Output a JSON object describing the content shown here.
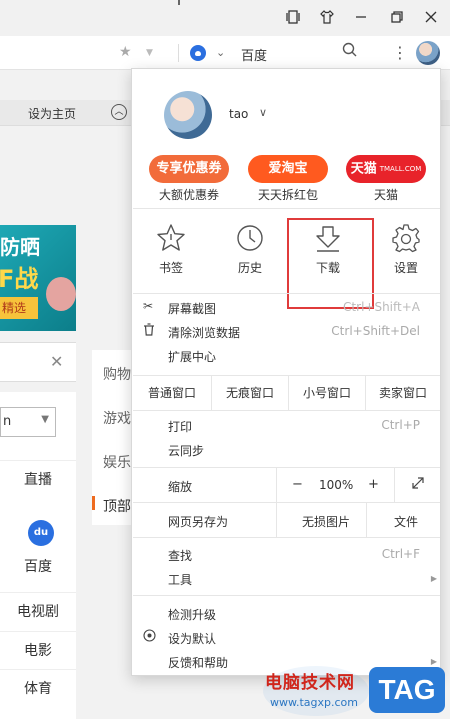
{
  "browser": {
    "search_engine": "百度"
  },
  "page": {
    "bookmark_set_home": "设为主页",
    "banner": {
      "line1": "防晒",
      "line2": "F战",
      "button": "精选"
    },
    "select_value": "n",
    "categories": [
      "直播",
      "百度",
      "电视剧",
      "电影",
      "体育"
    ],
    "baidu_logo_text": "du",
    "mid_items": [
      "购物",
      "游戏",
      "娱乐",
      "顶部"
    ]
  },
  "menu": {
    "username": "tao",
    "promos": [
      {
        "label": "专享优惠券",
        "caption": "大额优惠券",
        "color": "#f26b3a"
      },
      {
        "label": "爱淘宝",
        "caption": "天天拆红包",
        "color": "#ff5a1f"
      },
      {
        "label": "天猫",
        "sub": "TMALL.COM",
        "caption": "天猫",
        "color": "#e8232a"
      }
    ],
    "tools": [
      {
        "label": "书签",
        "icon": "star-icon"
      },
      {
        "label": "历史",
        "icon": "clock-icon"
      },
      {
        "label": "下载",
        "icon": "download-icon"
      },
      {
        "label": "设置",
        "icon": "gear-icon"
      }
    ],
    "screenshot": {
      "label": "屏幕截图",
      "hotkey": "Ctrl+Shift+A"
    },
    "clear_data": {
      "label": "清除浏览数据",
      "hotkey": "Ctrl+Shift+Del"
    },
    "extensions": {
      "label": "扩展中心"
    },
    "windows": [
      "普通窗口",
      "无痕窗口",
      "小号窗口",
      "卖家窗口"
    ],
    "print": {
      "label": "打印",
      "hotkey": "Ctrl+P"
    },
    "cloud_sync": {
      "label": "云同步"
    },
    "zoom": {
      "label": "缩放",
      "minus": "−",
      "value": "100%",
      "plus": "+"
    },
    "save_as": {
      "label": "网页另存为",
      "lossless": "无损图片",
      "file": "文件"
    },
    "find": {
      "label": "查找",
      "hotkey": "Ctrl+F"
    },
    "tools_menu": {
      "label": "工具"
    },
    "upgrade": {
      "label": "检测升级"
    },
    "set_default": {
      "label": "设为默认"
    },
    "feedback": {
      "label": "反馈和帮助"
    }
  },
  "watermark": {
    "title": "电脑技术网",
    "url": "www.tagxp.com",
    "tag": "TAG"
  }
}
